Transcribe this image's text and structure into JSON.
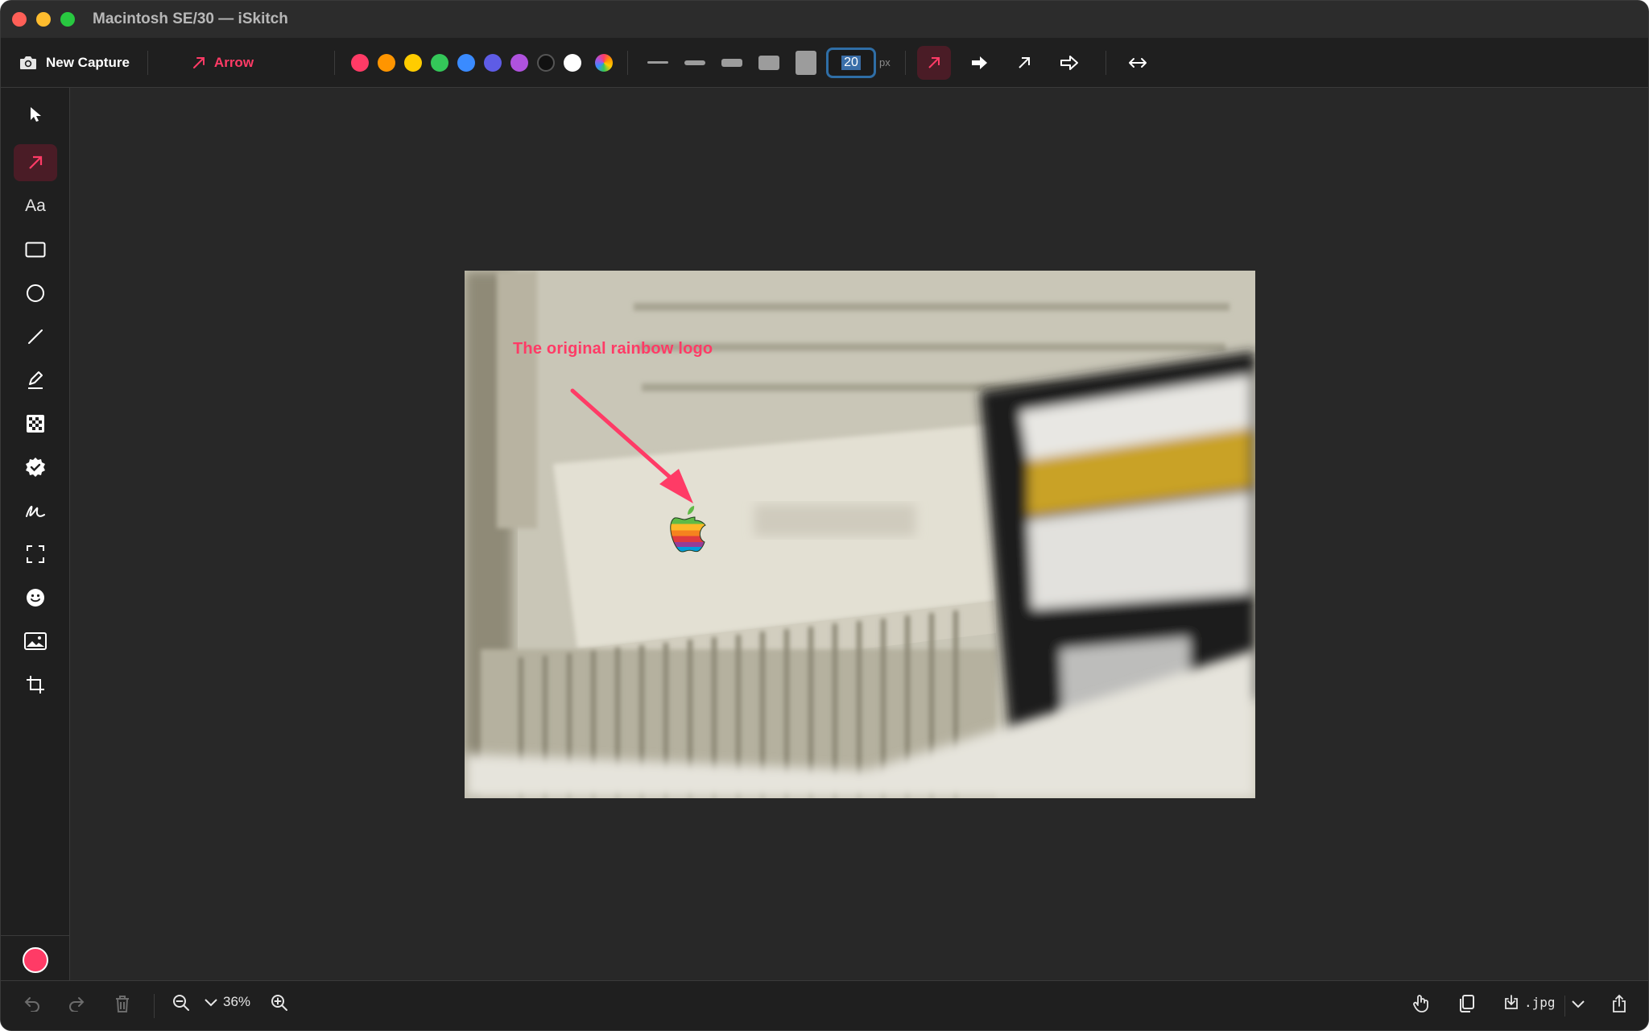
{
  "window": {
    "title": "Macintosh SE/30 — iSkitch"
  },
  "toolbar": {
    "new_capture_label": "New Capture",
    "current_tool_label": "Arrow",
    "colors": [
      "#ff3b66",
      "#ff9500",
      "#ffcc00",
      "#34c759",
      "#3a8bff",
      "#5e5ce6",
      "#af52de",
      "#111111",
      "#ffffff"
    ],
    "stroke_width_value": "20",
    "stroke_width_unit": "px",
    "active_color": "#ff3b66"
  },
  "sidebar": {
    "text_tool_label": "Aa",
    "tools": [
      "pointer",
      "arrow",
      "text",
      "rectangle",
      "ellipse",
      "line",
      "highlighter",
      "pixelate",
      "stamp",
      "freehand",
      "selection",
      "emoji",
      "image",
      "crop"
    ],
    "active_tool": "arrow"
  },
  "canvas": {
    "annotation_text": "The original rainbow logo"
  },
  "bottombar": {
    "zoom_label": "36%",
    "format_label": ".jpg"
  }
}
